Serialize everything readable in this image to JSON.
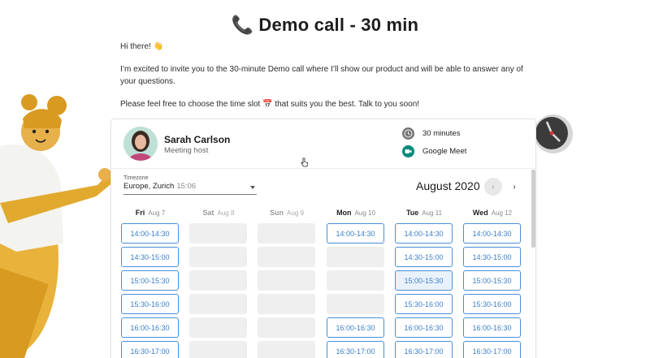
{
  "title": "Demo call - 30 min",
  "intro": {
    "greeting": "Hi there! 👋",
    "p1": "I’m excited to invite you to the 30-minute Demo call where I’ll show our product and will be able to answer any of your questions.",
    "p2": "Please feel free to choose the time slot 📅  that suits you the best. Talk to you soon!"
  },
  "host": {
    "name": "Sarah Carlson",
    "role": "Meeting host",
    "duration": "30 minutes",
    "platform": "Google Meet"
  },
  "timezone": {
    "label": "Timezone",
    "value": "Europe, Zurich",
    "time": "15:06"
  },
  "calendar": {
    "month": "August 2020",
    "prev": "‹",
    "next": "›"
  },
  "days": [
    {
      "name": "Fri",
      "date": "Aug 7",
      "disabled": false,
      "slots": [
        "14:00-14:30",
        "14:30-15:00",
        "15:00-15:30",
        "15:30-16:00",
        "16:00-16:30",
        "16:30-17:00"
      ]
    },
    {
      "name": "Sat",
      "date": "Aug 8",
      "disabled": true,
      "slots": [
        "",
        "",
        "",
        "",
        "",
        ""
      ]
    },
    {
      "name": "Sun",
      "date": "Aug 9",
      "disabled": true,
      "slots": [
        "",
        "",
        "",
        "",
        "",
        ""
      ]
    },
    {
      "name": "Mon",
      "date": "Aug 10",
      "disabled": false,
      "slots": [
        "14:00-14:30",
        "",
        "",
        "",
        "16:00-16:30",
        "16:30-17:00"
      ]
    },
    {
      "name": "Tue",
      "date": "Aug 11",
      "disabled": false,
      "slots": [
        "14:00-14:30",
        "14:30-15:00",
        "15:00-15:30",
        "15:30-16:00",
        "16:00-16:30",
        "16:30-17:00"
      ]
    },
    {
      "name": "Wed",
      "date": "Aug 12",
      "disabled": false,
      "slots": [
        "14:00-14:30",
        "14:30-15:00",
        "15:00-15:30",
        "15:30-16:00",
        "16:00-16:30",
        "16:30-17:00"
      ]
    }
  ],
  "hovered_slot": "Tue 15:00-15:30",
  "colors": {
    "accent": "#4a8fd8",
    "meet": "#00897b",
    "clock_icon": "#757575"
  }
}
